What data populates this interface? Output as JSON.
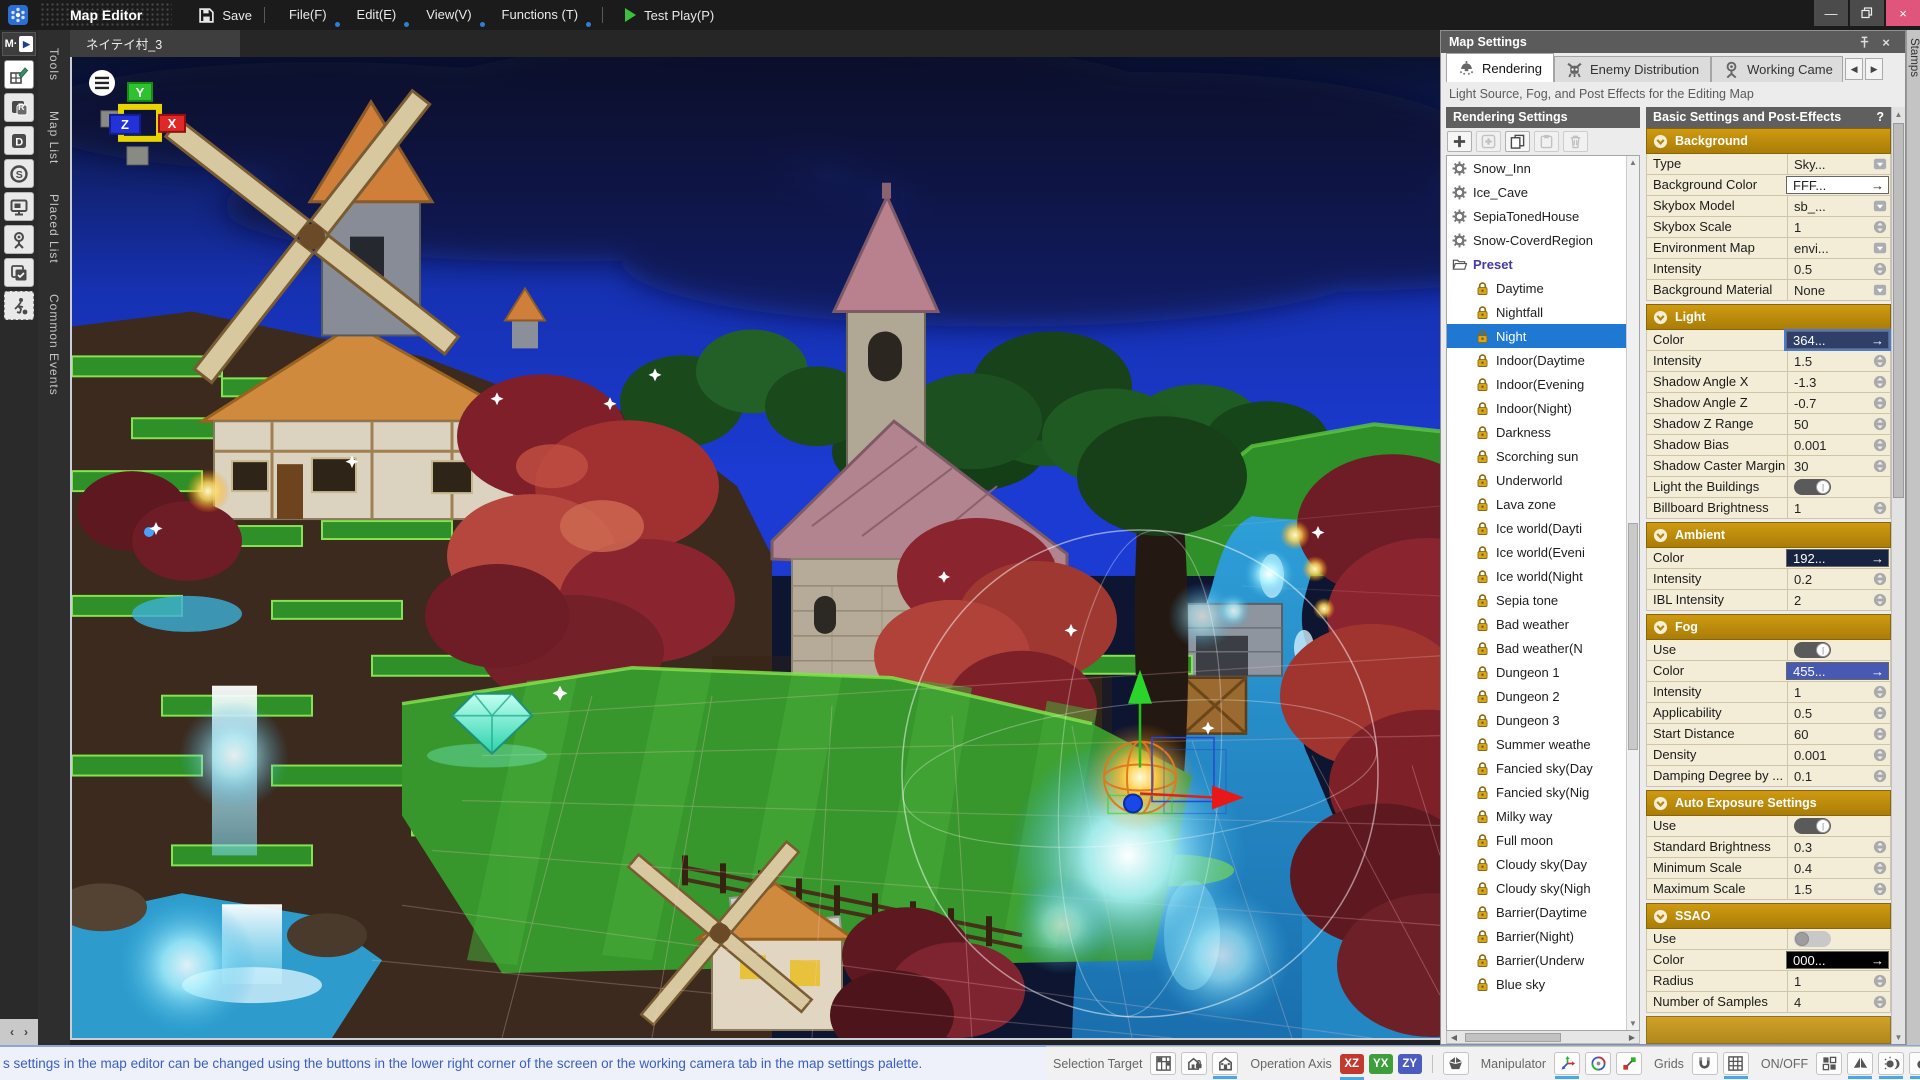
{
  "titlebar": {
    "app_icon": "app-logo-icon",
    "title": "Map Editor",
    "save_label": "Save",
    "menus": [
      {
        "label": "File(F)"
      },
      {
        "label": "Edit(E)"
      },
      {
        "label": "View(V)"
      },
      {
        "label": "Functions (T)"
      }
    ],
    "test_play_label": "Test Play(P)",
    "window_controls": [
      "minimize-icon",
      "restore-icon",
      "close-icon"
    ]
  },
  "doc_tab": {
    "label": "ネイテイ村_3"
  },
  "sidebar": {
    "menu_button": "M·",
    "tools": [
      {
        "icon": "map-edit-icon",
        "active": true
      },
      {
        "icon": "resource-icon"
      },
      {
        "icon": "database-icon"
      },
      {
        "icon": "system-icon"
      },
      {
        "icon": "display-icon"
      },
      {
        "icon": "camera-event-icon"
      },
      {
        "icon": "stamp-icon"
      },
      {
        "icon": "event-runner-icon",
        "dashed": true
      }
    ],
    "tabs": [
      {
        "label": "Tools"
      },
      {
        "label": "Map List"
      },
      {
        "label": "Placed List"
      },
      {
        "label": "Common Events"
      }
    ]
  },
  "viewport": {
    "menu_icon": "menu-icon",
    "axis": {
      "x": "X",
      "y": "Y",
      "z": "Z"
    }
  },
  "map_settings": {
    "title": "Map Settings",
    "header_icons": [
      "pin-icon",
      "close-icon"
    ],
    "tabs": [
      {
        "label": "Rendering",
        "icon": "light-icon",
        "active": true
      },
      {
        "label": "Enemy Distribution",
        "icon": "enemy-icon"
      },
      {
        "label": "Working Came",
        "icon": "camera-icon",
        "clipped": true
      }
    ],
    "description": "Light Source, Fog, and Post Effects for the Editing Map",
    "list_panel": {
      "header": "Rendering Settings",
      "toolbar": [
        {
          "icon": "add-icon",
          "enabled": true
        },
        {
          "icon": "add-child-icon",
          "enabled": false
        },
        {
          "icon": "duplicate-icon",
          "enabled": true
        },
        {
          "icon": "paste-icon",
          "enabled": false
        },
        {
          "icon": "delete-icon",
          "enabled": false
        }
      ],
      "items": [
        {
          "icon": "gear-icon",
          "label": "Snow_Inn"
        },
        {
          "icon": "gear-icon",
          "label": "Ice_Cave"
        },
        {
          "icon": "gear-icon",
          "label": "SepiaTonedHouse"
        },
        {
          "icon": "gear-icon",
          "label": "Snow-CoverdRegion"
        },
        {
          "icon": "folder-icon",
          "label": "Preset",
          "folder": true
        },
        {
          "icon": "lock-icon",
          "label": "Daytime",
          "child": true
        },
        {
          "icon": "lock-icon",
          "label": "Nightfall",
          "child": true
        },
        {
          "icon": "lock-icon",
          "label": "Night",
          "child": true,
          "selected": true
        },
        {
          "icon": "lock-icon",
          "label": "Indoor(Daytime",
          "child": true
        },
        {
          "icon": "lock-icon",
          "label": "Indoor(Evening",
          "child": true
        },
        {
          "icon": "lock-icon",
          "label": "Indoor(Night)",
          "child": true
        },
        {
          "icon": "lock-icon",
          "label": "Darkness",
          "child": true
        },
        {
          "icon": "lock-icon",
          "label": "Scorching sun",
          "child": true
        },
        {
          "icon": "lock-icon",
          "label": "Underworld",
          "child": true
        },
        {
          "icon": "lock-icon",
          "label": "Lava zone",
          "child": true
        },
        {
          "icon": "lock-icon",
          "label": "Ice world(Dayti",
          "child": true
        },
        {
          "icon": "lock-icon",
          "label": "Ice world(Eveni",
          "child": true
        },
        {
          "icon": "lock-icon",
          "label": "Ice world(Night",
          "child": true
        },
        {
          "icon": "lock-icon",
          "label": "Sepia tone",
          "child": true
        },
        {
          "icon": "lock-icon",
          "label": "Bad weather",
          "child": true
        },
        {
          "icon": "lock-icon",
          "label": "Bad weather(N",
          "child": true
        },
        {
          "icon": "lock-icon",
          "label": "Dungeon 1",
          "child": true
        },
        {
          "icon": "lock-icon",
          "label": "Dungeon 2",
          "child": true
        },
        {
          "icon": "lock-icon",
          "label": "Dungeon 3",
          "child": true
        },
        {
          "icon": "lock-icon",
          "label": "Summer weathe",
          "child": true
        },
        {
          "icon": "lock-icon",
          "label": "Fancied sky(Day",
          "child": true
        },
        {
          "icon": "lock-icon",
          "label": "Fancied sky(Nig",
          "child": true
        },
        {
          "icon": "lock-icon",
          "label": "Milky way",
          "child": true
        },
        {
          "icon": "lock-icon",
          "label": "Full moon",
          "child": true
        },
        {
          "icon": "lock-icon",
          "label": "Cloudy sky(Day",
          "child": true
        },
        {
          "icon": "lock-icon",
          "label": "Cloudy sky(Nigh",
          "child": true
        },
        {
          "icon": "lock-icon",
          "label": "Barrier(Daytime",
          "child": true
        },
        {
          "icon": "lock-icon",
          "label": "Barrier(Night)",
          "child": true
        },
        {
          "icon": "lock-icon",
          "label": "Barrier(Underw",
          "child": true
        },
        {
          "icon": "lock-icon",
          "label": "Blue sky",
          "child": true
        }
      ]
    },
    "props_panel": {
      "header": "Basic Settings and Post-Effects",
      "help": "?",
      "groups": [
        {
          "title": "Background",
          "rows": [
            {
              "label": "Type",
              "value": "Sky...",
              "control": "dropdown"
            },
            {
              "label": "Background Color",
              "value": "FFF...",
              "control": "color",
              "swatch": "#ffffff",
              "text_color": "#222222"
            },
            {
              "label": "Skybox Model",
              "value": "sb_...",
              "control": "dropdown"
            },
            {
              "label": "Skybox Scale",
              "value": "1",
              "control": "spinner"
            },
            {
              "label": "Environment Map",
              "value": "envi...",
              "control": "dropdown"
            },
            {
              "label": "Intensity",
              "value": "0.5",
              "control": "spinner"
            },
            {
              "label": "Background Material",
              "value": "None",
              "control": "dropdown"
            }
          ]
        },
        {
          "title": "Light",
          "rows": [
            {
              "label": "Color",
              "value": "364...",
              "control": "color",
              "swatch": "#2e3f68",
              "text_color": "#ffffff",
              "focused": true
            },
            {
              "label": "Intensity",
              "value": "1.5",
              "control": "spinner"
            },
            {
              "label": "Shadow Angle X",
              "value": "-1.3",
              "control": "spinner"
            },
            {
              "label": "Shadow Angle Z",
              "value": "-0.7",
              "control": "spinner"
            },
            {
              "label": "Shadow Z Range",
              "value": "50",
              "control": "spinner"
            },
            {
              "label": "Shadow Bias",
              "value": "0.001",
              "control": "spinner"
            },
            {
              "label": "Shadow Caster Margin",
              "value": "30",
              "control": "spinner"
            },
            {
              "label": "Light the Buildings",
              "control": "toggle",
              "on": true
            },
            {
              "label": "Billboard Brightness",
              "value": "1",
              "control": "spinner"
            }
          ]
        },
        {
          "title": "Ambient",
          "rows": [
            {
              "label": "Color",
              "value": "192...",
              "control": "color",
              "swatch": "#172441",
              "text_color": "#ffffff"
            },
            {
              "label": "Intensity",
              "value": "0.2",
              "control": "spinner"
            },
            {
              "label": "IBL Intensity",
              "value": "2",
              "control": "spinner"
            }
          ]
        },
        {
          "title": "Fog",
          "rows": [
            {
              "label": "Use",
              "control": "toggle",
              "on": true
            },
            {
              "label": "Color",
              "value": "455...",
              "control": "color",
              "swatch": "#4859b4",
              "text_color": "#ffffff"
            },
            {
              "label": "Intensity",
              "value": "1",
              "control": "spinner"
            },
            {
              "label": "Applicability",
              "value": "0.5",
              "control": "spinner"
            },
            {
              "label": "Start Distance",
              "value": "60",
              "control": "spinner"
            },
            {
              "label": "Density",
              "value": "0.001",
              "control": "spinner"
            },
            {
              "label": "Damping Degree by ...",
              "value": "0.1",
              "control": "spinner"
            }
          ]
        },
        {
          "title": "Auto Exposure Settings",
          "rows": [
            {
              "label": "Use",
              "control": "toggle",
              "on": true
            },
            {
              "label": "Standard Brightness",
              "value": "0.3",
              "control": "spinner"
            },
            {
              "label": "Minimum Scale",
              "value": "0.4",
              "control": "spinner"
            },
            {
              "label": "Maximum Scale",
              "value": "1.5",
              "control": "spinner"
            }
          ]
        },
        {
          "title": "SSAO",
          "rows": [
            {
              "label": "Use",
              "control": "toggle",
              "on": false
            },
            {
              "label": "Color",
              "value": "000...",
              "control": "color",
              "swatch": "#000000",
              "text_color": "#ffffff"
            },
            {
              "label": "Radius",
              "value": "1",
              "control": "spinner"
            },
            {
              "label": "Number of Samples",
              "value": "4",
              "control": "spinner"
            }
          ]
        }
      ]
    }
  },
  "stamps_tab": {
    "label": "Stamps"
  },
  "statusbar": {
    "message": "s settings in the map editor can be changed using the buttons in the lower right corner of the screen or the working camera tab in the map settings palette.",
    "groups": [
      {
        "label": "Selection Target",
        "buttons": [
          {
            "icon": "selection-grid-icon"
          },
          {
            "icon": "building-lock-icon"
          },
          {
            "icon": "building-icon",
            "active": true
          }
        ]
      },
      {
        "label": "Operation Axis",
        "buttons": [
          {
            "icon": "axis-xz-icon",
            "text": "XZ",
            "bg": "#c23a2e",
            "active": true
          },
          {
            "icon": "axis-yx-icon",
            "text": "YX",
            "bg": "#3e9e3c"
          },
          {
            "icon": "axis-zy-icon",
            "text": "ZY",
            "bg": "#4a5cc0"
          }
        ]
      },
      {
        "divider": true
      },
      {
        "buttons": [
          {
            "icon": "coordinate-space-icon"
          }
        ]
      },
      {
        "label": "Manipulator",
        "buttons": [
          {
            "icon": "move-icon",
            "active": true
          },
          {
            "icon": "rotate-icon"
          },
          {
            "icon": "scale-icon"
          }
        ]
      },
      {
        "label": "Grids",
        "buttons": [
          {
            "icon": "snap-magnet-icon"
          },
          {
            "icon": "grid-icon",
            "active": true
          }
        ]
      },
      {
        "label": "ON/OFF",
        "buttons": [
          {
            "icon": "layout-icon"
          },
          {
            "icon": "terrain-icon",
            "active": true
          },
          {
            "icon": "daynight-icon",
            "active": true
          },
          {
            "icon": "effect-icon",
            "active": true
          },
          {
            "icon": "enemy-icon"
          }
        ]
      }
    ]
  }
}
